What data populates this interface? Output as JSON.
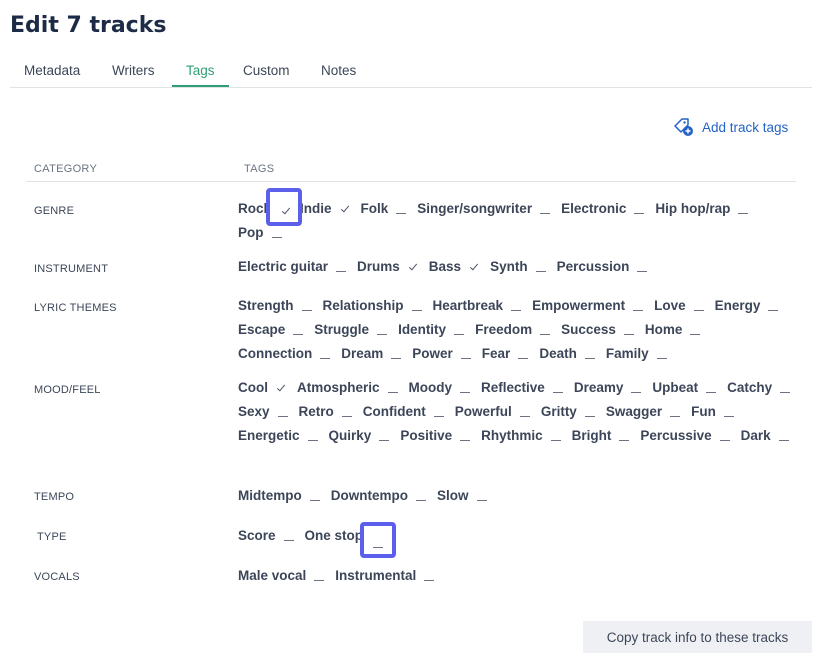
{
  "page": {
    "title": "Edit 7 tracks"
  },
  "tabs": [
    {
      "label": "Metadata"
    },
    {
      "label": "Writers"
    },
    {
      "label": "Tags"
    },
    {
      "label": "Custom"
    },
    {
      "label": "Notes"
    }
  ],
  "active_tab": "Tags",
  "add_tags": {
    "label": "Add track tags"
  },
  "table": {
    "category_header": "CATEGORY",
    "tags_header": "TAGS"
  },
  "categories": [
    {
      "label": "GENRE",
      "tags": [
        {
          "name": "Rock",
          "state": "checked"
        },
        {
          "name": "Indie",
          "state": "checked"
        },
        {
          "name": "Folk",
          "state": "dash"
        },
        {
          "name": "Singer/songwriter",
          "state": "dash"
        },
        {
          "name": "Electronic",
          "state": "dash"
        },
        {
          "name": "Hip hop/rap",
          "state": "dash"
        },
        {
          "name": "Pop",
          "state": "dash"
        }
      ]
    },
    {
      "label": "INSTRUMENT",
      "tags": [
        {
          "name": "Electric guitar",
          "state": "dash"
        },
        {
          "name": "Drums",
          "state": "checked"
        },
        {
          "name": "Bass",
          "state": "checked"
        },
        {
          "name": "Synth",
          "state": "dash"
        },
        {
          "name": "Percussion",
          "state": "dash"
        }
      ]
    },
    {
      "label": "LYRIC THEMES",
      "tags": [
        {
          "name": "Strength",
          "state": "dash"
        },
        {
          "name": "Relationship",
          "state": "dash"
        },
        {
          "name": "Heartbreak",
          "state": "dash"
        },
        {
          "name": "Empowerment",
          "state": "dash"
        },
        {
          "name": "Love",
          "state": "dash"
        },
        {
          "name": "Energy",
          "state": "dash"
        },
        {
          "name": "Escape",
          "state": "dash"
        },
        {
          "name": "Struggle",
          "state": "dash"
        },
        {
          "name": "Identity",
          "state": "dash"
        },
        {
          "name": "Freedom",
          "state": "dash"
        },
        {
          "name": "Success",
          "state": "dash"
        },
        {
          "name": "Home",
          "state": "dash"
        },
        {
          "name": "Connection",
          "state": "dash"
        },
        {
          "name": "Dream",
          "state": "dash"
        },
        {
          "name": "Power",
          "state": "dash"
        },
        {
          "name": "Fear",
          "state": "dash"
        },
        {
          "name": "Death",
          "state": "dash"
        },
        {
          "name": "Family",
          "state": "dash"
        }
      ]
    },
    {
      "label": "MOOD/FEEL",
      "tags": [
        {
          "name": "Cool",
          "state": "checked"
        },
        {
          "name": "Atmospheric",
          "state": "dash"
        },
        {
          "name": "Moody",
          "state": "dash"
        },
        {
          "name": "Reflective",
          "state": "dash"
        },
        {
          "name": "Dreamy",
          "state": "dash"
        },
        {
          "name": "Upbeat",
          "state": "dash"
        },
        {
          "name": "Catchy",
          "state": "dash"
        },
        {
          "name": "Sexy",
          "state": "dash"
        },
        {
          "name": "Retro",
          "state": "dash"
        },
        {
          "name": "Confident",
          "state": "dash"
        },
        {
          "name": "Powerful",
          "state": "dash"
        },
        {
          "name": "Gritty",
          "state": "dash"
        },
        {
          "name": "Swagger",
          "state": "dash"
        },
        {
          "name": "Fun",
          "state": "dash"
        },
        {
          "name": "Energetic",
          "state": "dash"
        },
        {
          "name": "Quirky",
          "state": "dash"
        },
        {
          "name": "Positive",
          "state": "dash"
        },
        {
          "name": "Rhythmic",
          "state": "dash"
        },
        {
          "name": "Bright",
          "state": "dash"
        },
        {
          "name": "Percussive",
          "state": "dash"
        },
        {
          "name": "Dark",
          "state": "dash"
        }
      ]
    },
    {
      "label": "TEMPO",
      "tags": [
        {
          "name": "Midtempo",
          "state": "dash"
        },
        {
          "name": "Downtempo",
          "state": "dash"
        },
        {
          "name": "Slow",
          "state": "dash"
        }
      ]
    },
    {
      "label": "TYPE",
      "tags": [
        {
          "name": "Score",
          "state": "dash"
        },
        {
          "name": "One stop",
          "state": "dash"
        }
      ]
    },
    {
      "label": "VOCALS",
      "tags": [
        {
          "name": "Male vocal",
          "state": "dash"
        },
        {
          "name": "Instrumental",
          "state": "dash"
        }
      ]
    }
  ],
  "copy_button": {
    "label": "Copy track info to these tracks"
  },
  "colors": {
    "accent": "#2f9e74",
    "link": "#2563c6",
    "highlight": "#5b5fe9",
    "title": "#1d2b46"
  }
}
